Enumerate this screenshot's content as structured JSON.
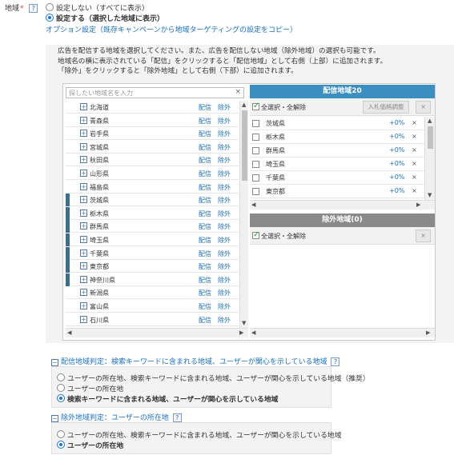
{
  "field": {
    "label": "地域",
    "required_mark": "*",
    "help": "?"
  },
  "mode": {
    "options": [
      "設定しない（すべてに表示）",
      "設定する（選択した地域に表示）"
    ],
    "selected_index": 1,
    "option_link": "オプション設定（既存キャンペーンから地域ターゲティングの設定をコピー）"
  },
  "description": [
    "広告を配信する地域を選択してください。また、広告を配信しない地域（除外地域）の選択も可能です。",
    "地域名の横に表示されている「配信」をクリックすると「配信地域」として右側（上部）に追加されます。",
    "「除外」をクリックすると「除外地域」として右側（下部）に追加されます。"
  ],
  "search": {
    "placeholder": "探したい地域名を入力",
    "clear": "×"
  },
  "prefectures": [
    {
      "name": "北海道",
      "selected": false
    },
    {
      "name": "青森県",
      "selected": false
    },
    {
      "name": "岩手県",
      "selected": false
    },
    {
      "name": "宮城県",
      "selected": false
    },
    {
      "name": "秋田県",
      "selected": false
    },
    {
      "name": "山形県",
      "selected": false
    },
    {
      "name": "福島県",
      "selected": false
    },
    {
      "name": "茨城県",
      "selected": true
    },
    {
      "name": "栃木県",
      "selected": true
    },
    {
      "name": "群馬県",
      "selected": true
    },
    {
      "name": "埼玉県",
      "selected": true
    },
    {
      "name": "千葉県",
      "selected": true
    },
    {
      "name": "東京都",
      "selected": true
    },
    {
      "name": "神奈川県",
      "selected": true
    },
    {
      "name": "新潟県",
      "selected": false
    },
    {
      "name": "富山県",
      "selected": false
    },
    {
      "name": "石川県",
      "selected": false
    }
  ],
  "row_actions": {
    "deliver": "配信",
    "exclude": "除外"
  },
  "delivery": {
    "title": "配信地域20",
    "select_all": "全選択・全解除",
    "bid_button": "入札価格調整",
    "remove_all": "×",
    "items": [
      {
        "name": "茨城県",
        "bid": "+0%"
      },
      {
        "name": "栃木県",
        "bid": "+0%"
      },
      {
        "name": "群馬県",
        "bid": "+0%"
      },
      {
        "name": "埼玉県",
        "bid": "+0%"
      },
      {
        "name": "千葉県",
        "bid": "+0%"
      },
      {
        "name": "東京都",
        "bid": "+0%"
      }
    ],
    "remove": "×"
  },
  "excluded": {
    "title": "除外地域(0)",
    "select_all": "全選択・全解除",
    "remove_all": "×"
  },
  "delivery_criteria": {
    "heading": "配信地域判定：検索キーワードに含まれる地域、ユーザーが関心を示している地域",
    "help": "?",
    "options": [
      "ユーザーの所在地、検索キーワードに含まれる地域、ユーザーが関心を示している地域（推奨）",
      "ユーザーの所在地",
      "検索キーワードに含まれる地域、ユーザーが関心を示している地域"
    ],
    "selected_index": 2
  },
  "exclusion_criteria": {
    "heading": "除外地域判定：ユーザーの所在地",
    "help": "?",
    "options": [
      "ユーザーの所在地、検索キーワードに含まれる地域、ユーザーが関心を示している地域",
      "ユーザーの所在地"
    ],
    "selected_index": 1
  },
  "colors": {
    "delivery_header": "#3a8fc0",
    "excluded_header": "#8a8a8a",
    "selected_marker": "#3c6e8f",
    "link": "#1a6fc4"
  }
}
